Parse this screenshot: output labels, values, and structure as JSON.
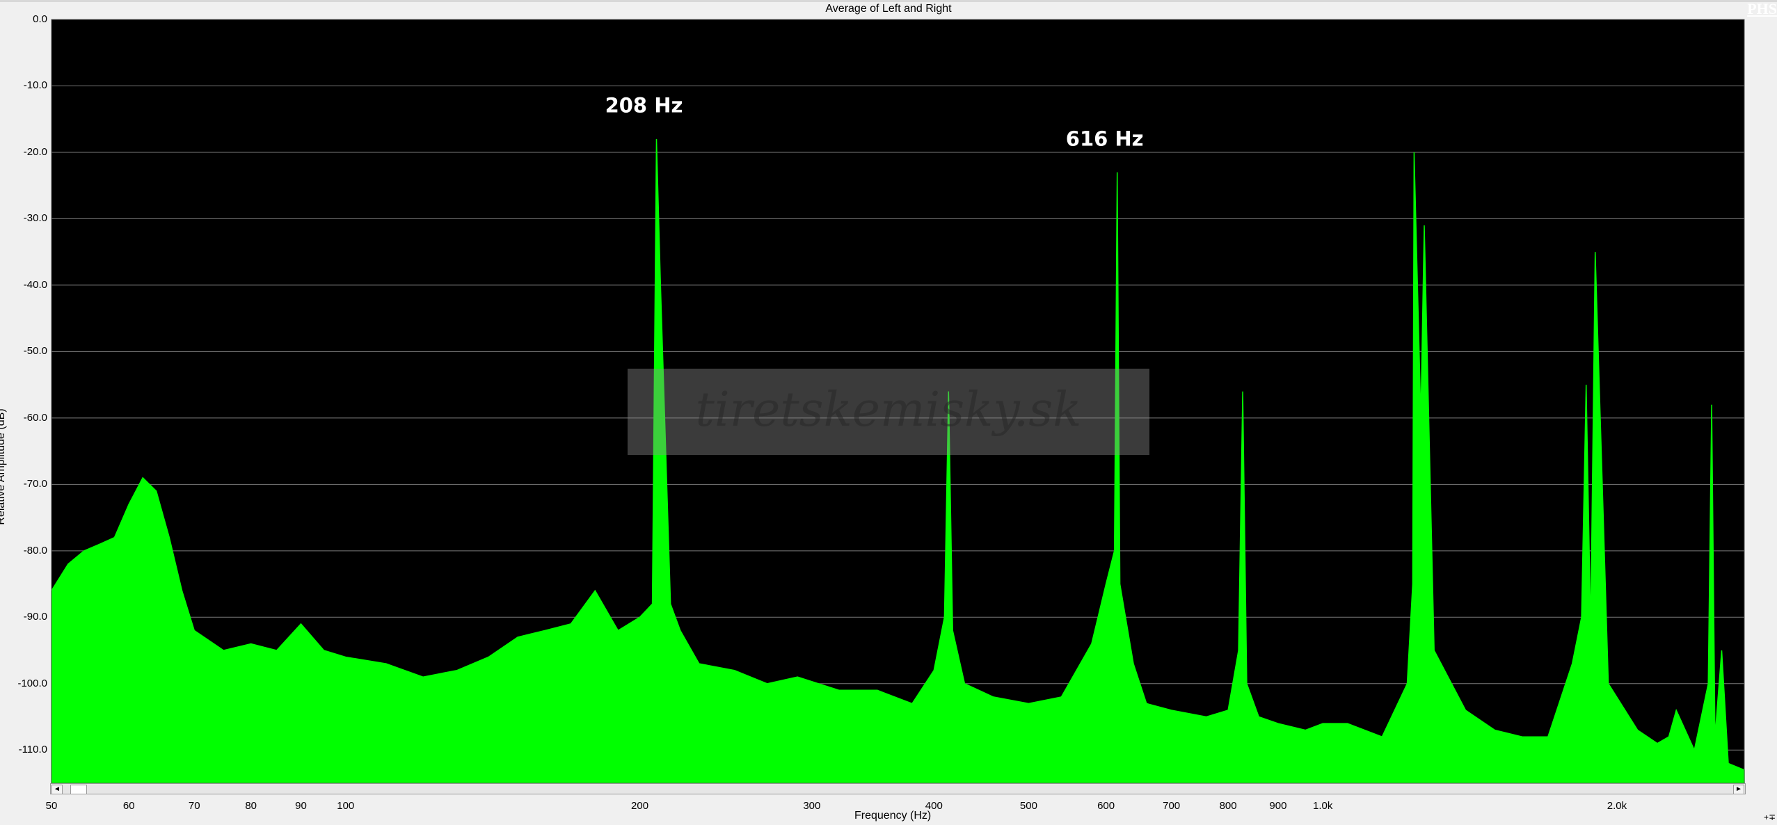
{
  "window": {
    "title": "Average of Left and Right",
    "badge": "PHS",
    "corner_label": "+∓"
  },
  "scrollbar": {
    "left_arrow": "◄",
    "right_arrow": "►"
  },
  "colors": {
    "background": "#000000",
    "spectrum": "#00ff00",
    "grid": "#7a7a7a",
    "frame": "#f0f0f0",
    "annotation": "#ffffff"
  },
  "watermark": {
    "text": "tiretskemisky.sk"
  },
  "chart_data": {
    "type": "area",
    "title": "Average of Left and Right",
    "xlabel": "Frequency (Hz)",
    "ylabel": "Relative Amplitude (dB)",
    "xscale": "log",
    "xlim": [
      50,
      2700
    ],
    "ylim": [
      -115,
      0
    ],
    "grid": true,
    "yticks": [
      0,
      -10,
      -20,
      -30,
      -40,
      -50,
      -60,
      -70,
      -80,
      -90,
      -100,
      -110
    ],
    "ytick_labels": [
      "0.0",
      "-10.0",
      "-20.0",
      "-30.0",
      "-40.0",
      "-50.0",
      "-60.0",
      "-70.0",
      "-80.0",
      "-90.0",
      "-100.0",
      "-110.0"
    ],
    "xticks": [
      50,
      60,
      70,
      80,
      90,
      100,
      200,
      300,
      400,
      500,
      600,
      700,
      800,
      900,
      1000,
      2000
    ],
    "xtick_labels": [
      "50",
      "60",
      "70",
      "80",
      "90",
      "100",
      "200",
      "300",
      "400",
      "500",
      "600",
      "700",
      "800",
      "900",
      "1.0k",
      "2.0k"
    ],
    "annotations": [
      {
        "text": "208 Hz",
        "x": 208,
        "y": -14
      },
      {
        "text": "616 Hz",
        "x": 616,
        "y": -19
      }
    ],
    "series": [
      {
        "x": [
          50,
          52,
          54,
          56,
          58,
          60,
          62,
          64,
          66,
          68,
          70,
          75,
          80,
          85,
          90,
          95,
          100,
          110,
          120,
          130,
          140,
          150,
          160,
          170,
          180,
          190,
          200,
          206,
          208,
          210,
          215,
          220,
          230,
          250,
          270,
          290,
          320,
          350,
          380,
          400,
          410,
          414,
          418,
          430,
          460,
          500,
          540,
          580,
          600,
          612,
          616,
          620,
          640,
          660,
          700,
          760,
          800,
          820,
          828,
          836,
          860,
          900,
          960,
          1000,
          1060,
          1150,
          1220,
          1236,
          1240,
          1260,
          1270,
          1300,
          1400,
          1500,
          1600,
          1700,
          1800,
          1840,
          1860,
          1880,
          1900,
          1960,
          2100,
          2200,
          2260,
          2300,
          2400,
          2480,
          2500,
          2520,
          2560,
          2600,
          2700
        ],
        "y": [
          -86,
          -82,
          -80,
          -79,
          -78,
          -73,
          -69,
          -71,
          -78,
          -86,
          -92,
          -95,
          -94,
          -95,
          -91,
          -95,
          -96,
          -97,
          -99,
          -98,
          -96,
          -93,
          -92,
          -91,
          -86,
          -92,
          -90,
          -88,
          -18,
          -40,
          -88,
          -92,
          -97,
          -98,
          -100,
          -99,
          -101,
          -101,
          -103,
          -98,
          -90,
          -56,
          -92,
          -100,
          -102,
          -103,
          -102,
          -94,
          -85,
          -80,
          -23,
          -85,
          -97,
          -103,
          -104,
          -105,
          -104,
          -95,
          -56,
          -100,
          -105,
          -106,
          -107,
          -106,
          -106,
          -108,
          -100,
          -85,
          -20,
          -60,
          -31,
          -95,
          -104,
          -107,
          -108,
          -108,
          -97,
          -90,
          -55,
          -92,
          -35,
          -100,
          -107,
          -109,
          -108,
          -104,
          -110,
          -100,
          -58,
          -108,
          -95,
          -112,
          -113
        ]
      }
    ]
  }
}
